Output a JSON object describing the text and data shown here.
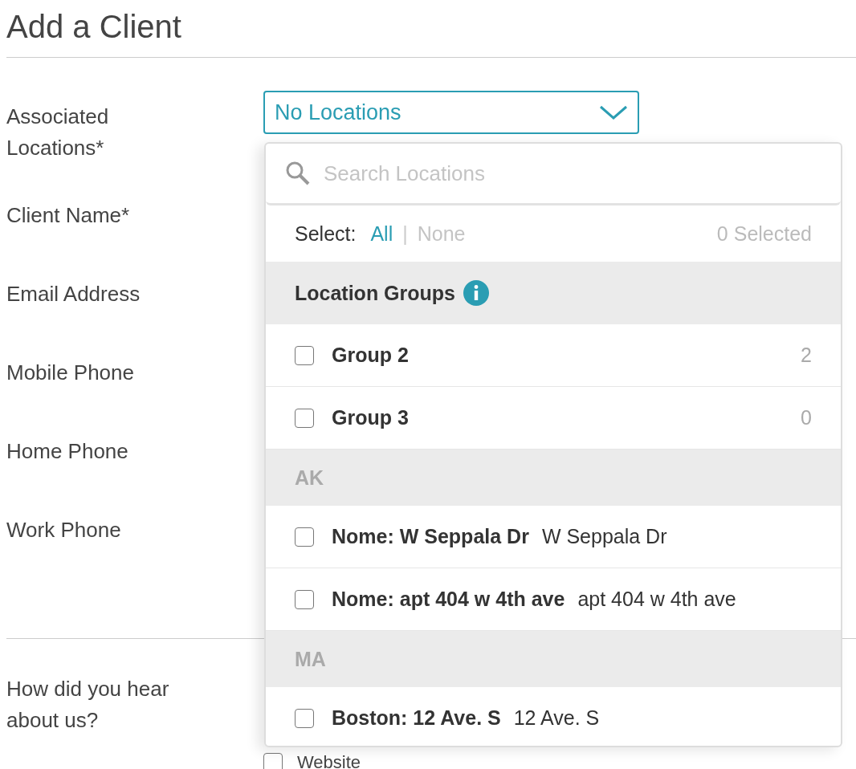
{
  "title": "Add a Client",
  "fields": [
    {
      "label": "Associated Locations*",
      "kind": "select",
      "value": "No Locations"
    },
    {
      "label": "Client Name*",
      "kind": "text"
    },
    {
      "label": "Email Address",
      "kind": "text"
    },
    {
      "label": "Mobile Phone",
      "kind": "text"
    },
    {
      "label": "Home Phone",
      "kind": "text"
    },
    {
      "label": "Work Phone",
      "kind": "text"
    }
  ],
  "dropdown": {
    "search": {
      "placeholder": "Search Locations"
    },
    "select_label": "Select:",
    "all": {
      "label": "All",
      "disabled": false
    },
    "separator": "|",
    "none": {
      "label": "None",
      "disabled": true
    },
    "selected_count": "0 Selected",
    "sections": [
      {
        "title": "Location Groups",
        "kind": "groups",
        "items": [
          {
            "name": "Group 2",
            "count": "2",
            "checked": false
          },
          {
            "name": "Group 3",
            "count": "0",
            "checked": false
          }
        ]
      },
      {
        "title": "AK",
        "kind": "region",
        "items": [
          {
            "name": "Nome: W Seppala Dr",
            "detail": "W Seppala Dr",
            "checked": false
          },
          {
            "name": "Nome: apt 404 w 4th ave",
            "detail": "apt 404 w 4th ave",
            "checked": false
          }
        ]
      },
      {
        "title": "MA",
        "kind": "region",
        "items": [
          {
            "name": "Boston: 12 Ave. S",
            "detail": "12 Ave. S",
            "checked": false
          }
        ]
      }
    ]
  },
  "referral": {
    "label": "How did you hear about us?",
    "options": [
      {
        "label": "Website",
        "checked": false
      }
    ]
  }
}
